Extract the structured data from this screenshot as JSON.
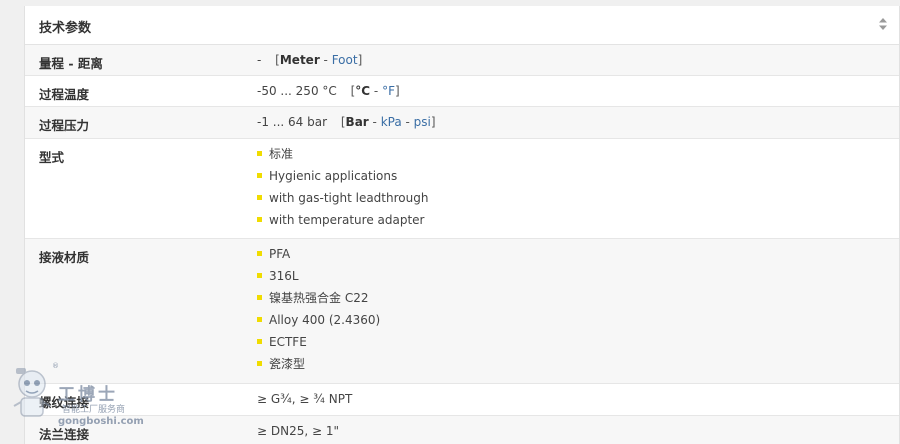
{
  "panel": {
    "title": "技术参数",
    "sort_icon": "sort-arrows-icon"
  },
  "rows": {
    "range": {
      "label": "量程 - 距离",
      "value": "-",
      "unit_open": "[",
      "unit_selected": "Meter",
      "unit_sep1": " - ",
      "unit_alt1": "Foot",
      "unit_close": "]"
    },
    "process_temp": {
      "label": "过程温度",
      "value": "-50 ... 250 °C",
      "unit_open": "[",
      "unit_selected": "°C",
      "unit_sep1": " - ",
      "unit_alt1": "°F",
      "unit_close": "]"
    },
    "process_pressure": {
      "label": "过程压力",
      "value": "-1 ... 64 bar",
      "unit_open": "[",
      "unit_selected": "Bar",
      "unit_sep1": " - ",
      "unit_alt1": "kPa",
      "unit_sep2": " - ",
      "unit_alt2": "psi",
      "unit_close": "]"
    },
    "type": {
      "label": "型式",
      "items": [
        "标准",
        "Hygienic applications",
        "with gas-tight leadthrough",
        "with temperature adapter"
      ]
    },
    "wetted_material": {
      "label": "接液材质",
      "items": [
        "PFA",
        "316L",
        "镍基热强合金 C22",
        "Alloy 400 (2.4360)",
        "ECTFE",
        "瓷漆型"
      ]
    },
    "thread": {
      "label": "螺纹连接",
      "value": "≥ G¾, ≥ ¾ NPT"
    },
    "flange": {
      "label": "法兰连接",
      "value": "≥ DN25, ≥ 1\""
    }
  },
  "watermark": {
    "brand": "工博士",
    "sub": "智能工厂服务商",
    "url": "gongboshi.com",
    "reg": "®"
  },
  "colors": {
    "bullet": "#f0dc00",
    "link": "#3a6ea5",
    "alt_row": "#f7f7f7"
  }
}
